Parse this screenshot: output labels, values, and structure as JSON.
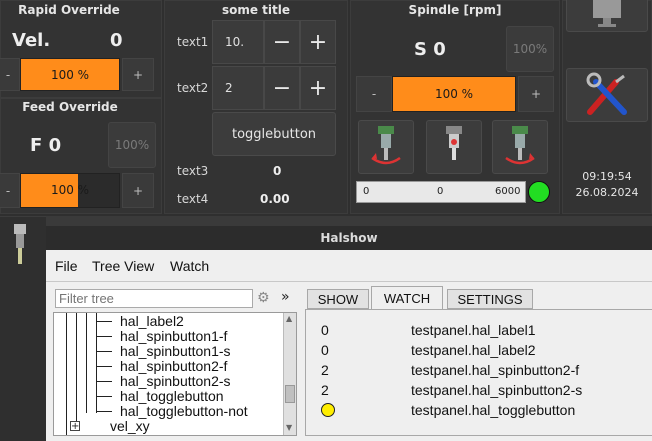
{
  "rapid": {
    "title": "Rapid Override",
    "label": "Vel.",
    "value": "0",
    "minus": "-",
    "plus": "+",
    "percent": "100 %"
  },
  "feed": {
    "title": "Feed Override",
    "label": "F 0",
    "pct_btn": "100%",
    "minus": "-",
    "plus": "+",
    "percent": "100 %",
    "fill_fraction": 0.58
  },
  "some": {
    "title": "some title",
    "text1": "text1",
    "spin1": "10.",
    "text2": "text2",
    "spin2": "2",
    "minus": "−",
    "plus": "+",
    "toggle": "togglebutton",
    "text3": "text3",
    "val3": "0",
    "text4": "text4",
    "val4": "0.00"
  },
  "spindle": {
    "title": "Spindle [rpm]",
    "value": "S 0",
    "pct_btn": "100%",
    "minus": "-",
    "plus": "+",
    "percent": "100 %",
    "bar_min": "0",
    "bar_value": "0",
    "bar_max": "6000",
    "led_color": "#22dd22"
  },
  "right": {
    "time": "09:19:54",
    "date": "26.08.2024"
  },
  "halshow": {
    "title": "Halshow",
    "menu": [
      "File",
      "Tree View",
      "Watch"
    ],
    "filter_placeholder": "Filter tree",
    "expand": "»",
    "tabs": [
      "SHOW",
      "WATCH",
      "SETTINGS"
    ],
    "active_tab": 1,
    "tree": [
      "hal_label2",
      "hal_spinbutton1-f",
      "hal_spinbutton1-s",
      "hal_spinbutton2-f",
      "hal_spinbutton2-s",
      "hal_togglebutton",
      "hal_togglebutton-not"
    ],
    "tree_parent": "vel_xy",
    "watch": [
      {
        "value": "0",
        "name": "testpanel.hal_label1"
      },
      {
        "value": "0",
        "name": "testpanel.hal_label2"
      },
      {
        "value": "2",
        "name": "testpanel.hal_spinbutton2-f"
      },
      {
        "value": "2",
        "name": "testpanel.hal_spinbutton2-s"
      },
      {
        "value": "",
        "name": "testpanel.hal_togglebutton",
        "led": "#ffee00"
      }
    ]
  }
}
